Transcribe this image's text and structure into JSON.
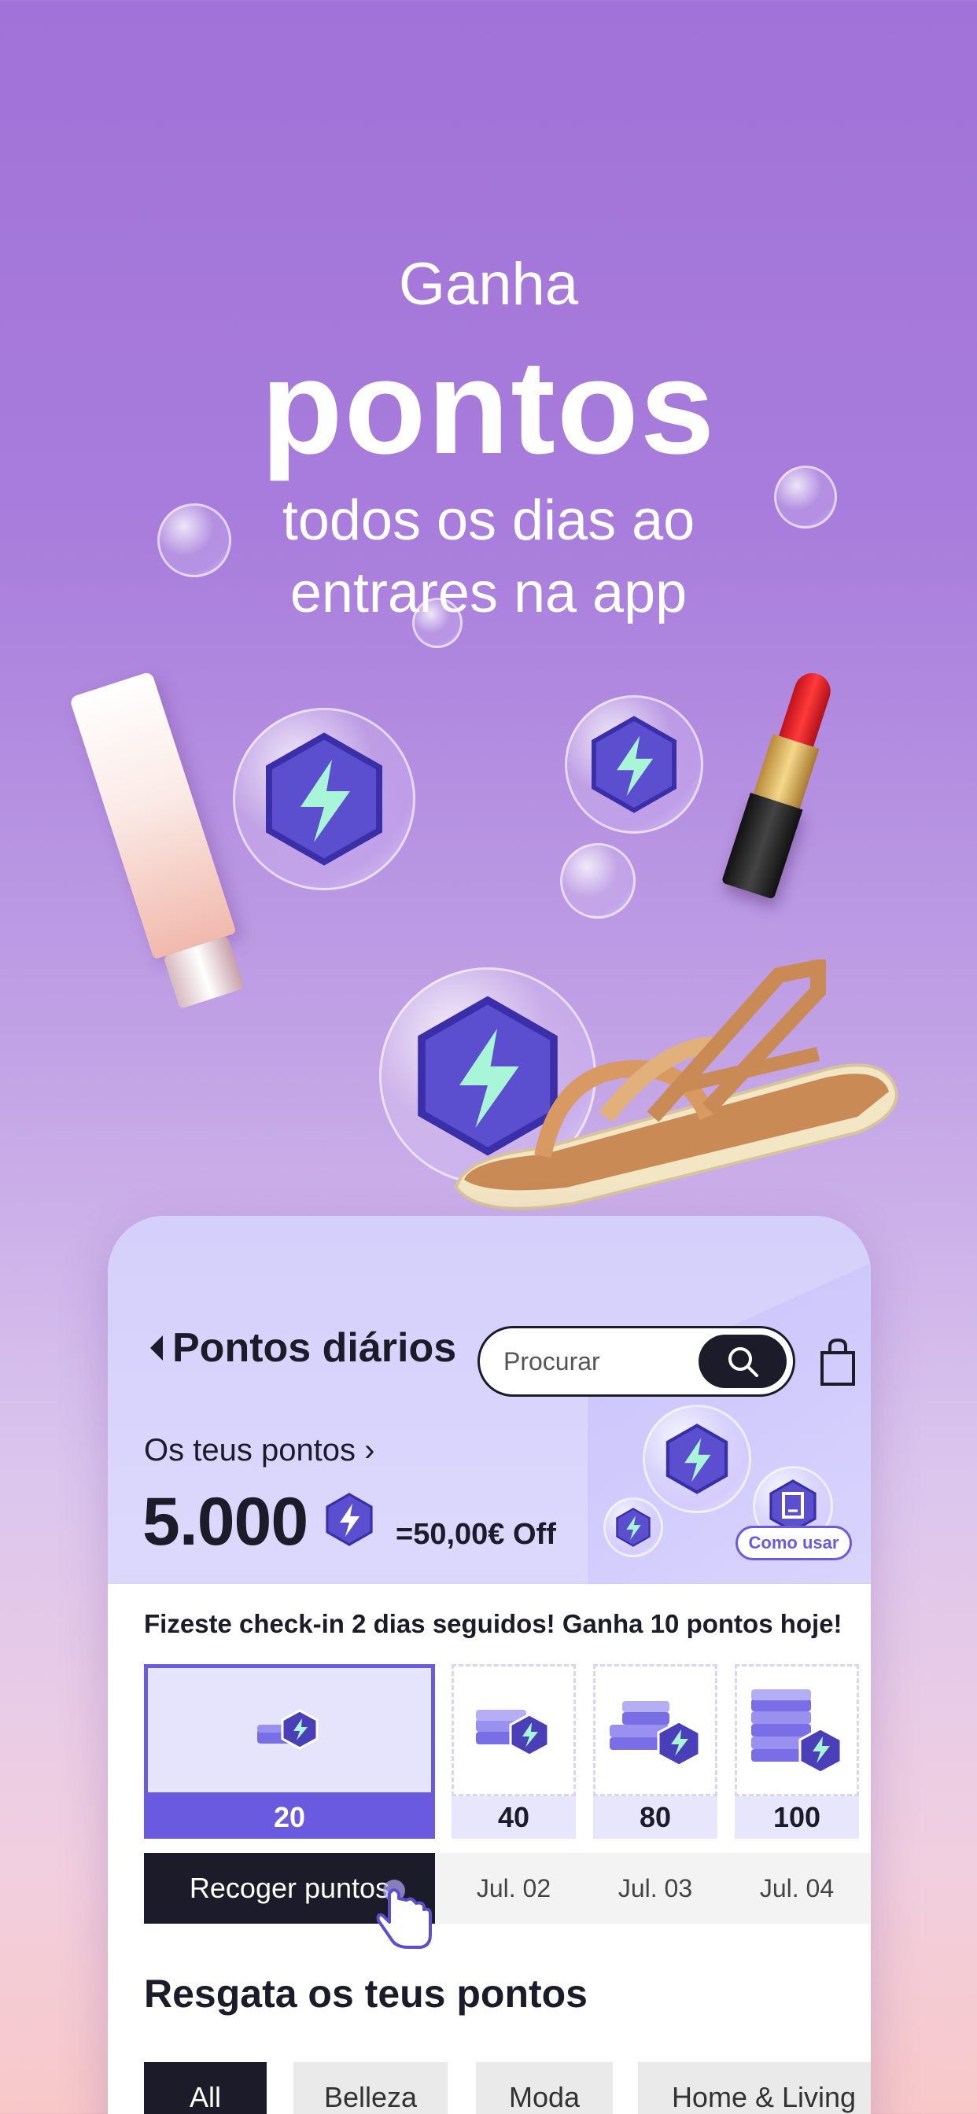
{
  "hero": {
    "line1": "Ganha",
    "line2": "pontos",
    "line3a": "todos os dias ao",
    "line3b": "entrares na app"
  },
  "colors": {
    "accent": "#6a5ae0",
    "dark": "#1c1b2a",
    "hex_fill": "#4a3fb8",
    "bolt": "#a8f5d8"
  },
  "header": {
    "title": "Pontos diários",
    "search_placeholder": "Procurar",
    "back_icon": "chevron-left-icon",
    "search_icon": "search-icon",
    "bag_icon": "shopping-bag-icon"
  },
  "points": {
    "label": "Os teus pontos ›",
    "value": "5.000",
    "equivalent": "=50,00€ Off",
    "how_to_use": "Como usar"
  },
  "checkin": {
    "message": "Fizeste check-in 2 dias seguidos! Ganha 10 pontos hoje!",
    "days": [
      {
        "points": "20",
        "date": "Recoger puntos",
        "active": true
      },
      {
        "points": "40",
        "date": "Jul. 02"
      },
      {
        "points": "80",
        "date": "Jul. 03"
      },
      {
        "points": "100",
        "date": "Jul. 04"
      }
    ]
  },
  "redeem": {
    "title": "Resgata os teus pontos",
    "categories": [
      "All",
      "Belleza",
      "Moda",
      "Home & Living"
    ]
  }
}
